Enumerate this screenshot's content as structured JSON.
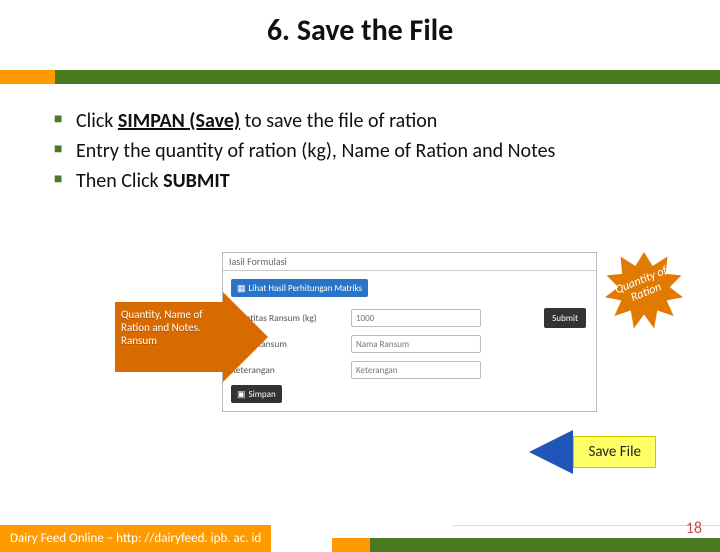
{
  "title": "6. Save the File",
  "bullets": [
    {
      "pre": "Click ",
      "em": "SIMPAN (Save)",
      "post": " to save the file of ration"
    },
    {
      "pre": "Entry the quantity of ration (kg), Name of Ration and Notes",
      "em": "",
      "post": ""
    },
    {
      "pre": "Then Click ",
      "em": "SUBMIT",
      "post": ""
    }
  ],
  "screenshot": {
    "header": "Iasil Formulasi",
    "matrix_btn": "Lihat Hasil Perhitungan Matriks",
    "rows": [
      {
        "label": "Kuantitas Ransum (kg)",
        "value": "1000"
      },
      {
        "label": "Nama Ransum",
        "value": "Nama Ransum"
      },
      {
        "label": "Keterangan",
        "value": "Keterangan"
      }
    ],
    "submit": "Submit",
    "simpan": "Simpan"
  },
  "left_callout": "Quantity, Name of Ration and Notes. Ransum",
  "burst": "Quantity of Ration",
  "save_callout": "Save File",
  "footer": "Dairy Feed Online – http: //dairyfeed. ipb. ac. id",
  "page": "18"
}
